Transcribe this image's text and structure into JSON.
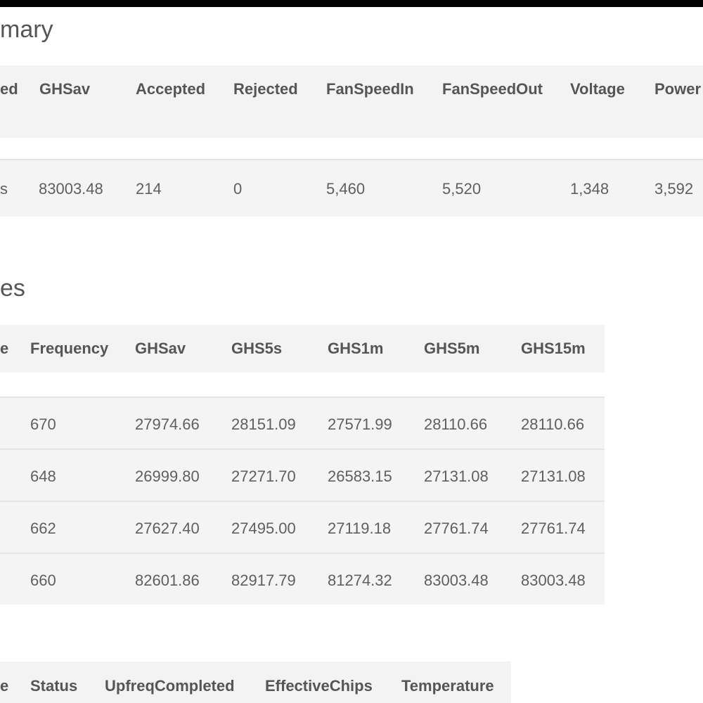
{
  "summary": {
    "title": "mary",
    "columns": [
      "ed",
      "GHSav",
      "Accepted",
      "Rejected",
      "FanSpeedIn",
      "FanSpeedOut",
      "Voltage",
      "Power"
    ],
    "row": [
      "s",
      "83003.48",
      "214",
      "0",
      "5,460",
      "5,520",
      "1,348",
      "3,592"
    ]
  },
  "devices": {
    "title": "es",
    "columns": [
      "e",
      "Frequency",
      "GHSav",
      "GHS5s",
      "GHS1m",
      "GHS5m",
      "GHS15m"
    ],
    "rows": [
      [
        "",
        "670",
        "27974.66",
        "28151.09",
        "27571.99",
        "28110.66",
        "28110.66"
      ],
      [
        "",
        "648",
        "26999.80",
        "27271.70",
        "26583.15",
        "27131.08",
        "27131.08"
      ],
      [
        "",
        "662",
        "27627.40",
        "27495.00",
        "27119.18",
        "27761.74",
        "27761.74"
      ],
      [
        "",
        "660",
        "82601.86",
        "82917.79",
        "81274.32",
        "83003.48",
        "83003.48"
      ]
    ]
  },
  "chains": {
    "columns": [
      "e",
      "Status",
      "UpfreqCompleted",
      "EffectiveChips",
      "Temperature"
    ]
  }
}
